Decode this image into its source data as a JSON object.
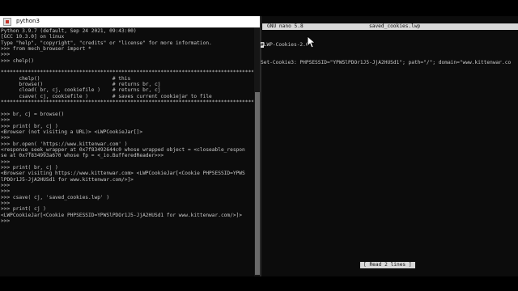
{
  "left_window": {
    "title": "python3",
    "terminal_lines": [
      "Python 3.9.7 (default, Sep 24 2021, 09:43:00)",
      "[GCC 10.3.0] on linux",
      "Type \"help\", \"copyright\", \"credits\" or \"license\" for more information.",
      ">>> from mech_browser import *",
      ">>>",
      ">>> chelp()",
      "",
      "*******************************************************************************************",
      "      chelp()                        # this",
      "      browse()                       # returns br, cj",
      "      cload( br, cj, cookiefile )    # returns br, cj",
      "      csave( cj, cookiefile )        # saves current cookiejar to file",
      "*******************************************************************************************",
      "",
      ">>> br, cj = browse()",
      ">>>",
      ">>> print( br, cj )",
      "<Browser (not visiting a URL)> <LWPCookieJar[]>",
      ">>>",
      ">>> br.open( 'https://www.kittenwar.com' )",
      "<response_seek_wrapper at 0x7f83492644c0 whose wrapped object = <closeable_respon",
      "se at 0x7f834993a670 whose fp = <_io.BufferedReader>>>",
      ">>>",
      ">>> print( br, cj )",
      "<Browser visiting https://www.kittenwar.com> <LWPCookieJar[<Cookie PHPSESSID=YPWS",
      "lPDOr1J5-JjA2HUSd1 for www.kittenwar.com/>]>",
      ">>>",
      ">>>",
      ">>> csave( cj, 'saved_cookies.lwp' )",
      ">>>",
      ">>> print( cj )",
      "<LWPCookieJar[<Cookie PHPSESSID=YPWSlPDOr1J5-JjA2HUSd1 for www.kittenwar.com/>]>",
      ">>>"
    ]
  },
  "right_window": {
    "nano_version": "GNU nano 5.8",
    "file_name": "saved_cookies.lwp",
    "line1": "#LWP-Cookies-2.0",
    "line2": "Set-Cookie3: PHPSESSID=\"YPWSlPDOr1J5-JjA2HUSd1\"; path=\"/\"; domain=\"www.kittenwar.co",
    "cursor_char": "#",
    "status_message": "[ Read 2 lines ]"
  },
  "icons": {
    "window_icon": "python-icon",
    "mouse": "mouse-pointer-icon"
  }
}
